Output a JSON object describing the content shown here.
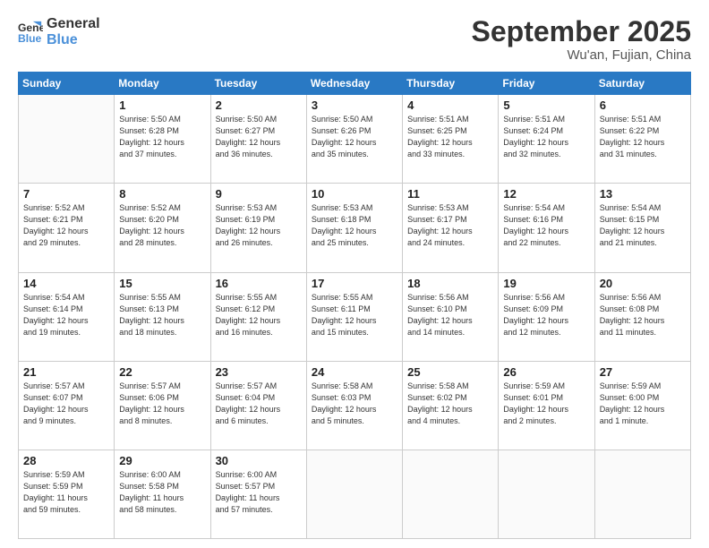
{
  "header": {
    "logo_line1": "General",
    "logo_line2": "Blue",
    "month": "September 2025",
    "location": "Wu'an, Fujian, China"
  },
  "weekdays": [
    "Sunday",
    "Monday",
    "Tuesday",
    "Wednesday",
    "Thursday",
    "Friday",
    "Saturday"
  ],
  "weeks": [
    [
      {
        "day": "",
        "info": ""
      },
      {
        "day": "1",
        "info": "Sunrise: 5:50 AM\nSunset: 6:28 PM\nDaylight: 12 hours\nand 37 minutes."
      },
      {
        "day": "2",
        "info": "Sunrise: 5:50 AM\nSunset: 6:27 PM\nDaylight: 12 hours\nand 36 minutes."
      },
      {
        "day": "3",
        "info": "Sunrise: 5:50 AM\nSunset: 6:26 PM\nDaylight: 12 hours\nand 35 minutes."
      },
      {
        "day": "4",
        "info": "Sunrise: 5:51 AM\nSunset: 6:25 PM\nDaylight: 12 hours\nand 33 minutes."
      },
      {
        "day": "5",
        "info": "Sunrise: 5:51 AM\nSunset: 6:24 PM\nDaylight: 12 hours\nand 32 minutes."
      },
      {
        "day": "6",
        "info": "Sunrise: 5:51 AM\nSunset: 6:22 PM\nDaylight: 12 hours\nand 31 minutes."
      }
    ],
    [
      {
        "day": "7",
        "info": "Sunrise: 5:52 AM\nSunset: 6:21 PM\nDaylight: 12 hours\nand 29 minutes."
      },
      {
        "day": "8",
        "info": "Sunrise: 5:52 AM\nSunset: 6:20 PM\nDaylight: 12 hours\nand 28 minutes."
      },
      {
        "day": "9",
        "info": "Sunrise: 5:53 AM\nSunset: 6:19 PM\nDaylight: 12 hours\nand 26 minutes."
      },
      {
        "day": "10",
        "info": "Sunrise: 5:53 AM\nSunset: 6:18 PM\nDaylight: 12 hours\nand 25 minutes."
      },
      {
        "day": "11",
        "info": "Sunrise: 5:53 AM\nSunset: 6:17 PM\nDaylight: 12 hours\nand 24 minutes."
      },
      {
        "day": "12",
        "info": "Sunrise: 5:54 AM\nSunset: 6:16 PM\nDaylight: 12 hours\nand 22 minutes."
      },
      {
        "day": "13",
        "info": "Sunrise: 5:54 AM\nSunset: 6:15 PM\nDaylight: 12 hours\nand 21 minutes."
      }
    ],
    [
      {
        "day": "14",
        "info": "Sunrise: 5:54 AM\nSunset: 6:14 PM\nDaylight: 12 hours\nand 19 minutes."
      },
      {
        "day": "15",
        "info": "Sunrise: 5:55 AM\nSunset: 6:13 PM\nDaylight: 12 hours\nand 18 minutes."
      },
      {
        "day": "16",
        "info": "Sunrise: 5:55 AM\nSunset: 6:12 PM\nDaylight: 12 hours\nand 16 minutes."
      },
      {
        "day": "17",
        "info": "Sunrise: 5:55 AM\nSunset: 6:11 PM\nDaylight: 12 hours\nand 15 minutes."
      },
      {
        "day": "18",
        "info": "Sunrise: 5:56 AM\nSunset: 6:10 PM\nDaylight: 12 hours\nand 14 minutes."
      },
      {
        "day": "19",
        "info": "Sunrise: 5:56 AM\nSunset: 6:09 PM\nDaylight: 12 hours\nand 12 minutes."
      },
      {
        "day": "20",
        "info": "Sunrise: 5:56 AM\nSunset: 6:08 PM\nDaylight: 12 hours\nand 11 minutes."
      }
    ],
    [
      {
        "day": "21",
        "info": "Sunrise: 5:57 AM\nSunset: 6:07 PM\nDaylight: 12 hours\nand 9 minutes."
      },
      {
        "day": "22",
        "info": "Sunrise: 5:57 AM\nSunset: 6:06 PM\nDaylight: 12 hours\nand 8 minutes."
      },
      {
        "day": "23",
        "info": "Sunrise: 5:57 AM\nSunset: 6:04 PM\nDaylight: 12 hours\nand 6 minutes."
      },
      {
        "day": "24",
        "info": "Sunrise: 5:58 AM\nSunset: 6:03 PM\nDaylight: 12 hours\nand 5 minutes."
      },
      {
        "day": "25",
        "info": "Sunrise: 5:58 AM\nSunset: 6:02 PM\nDaylight: 12 hours\nand 4 minutes."
      },
      {
        "day": "26",
        "info": "Sunrise: 5:59 AM\nSunset: 6:01 PM\nDaylight: 12 hours\nand 2 minutes."
      },
      {
        "day": "27",
        "info": "Sunrise: 5:59 AM\nSunset: 6:00 PM\nDaylight: 12 hours\nand 1 minute."
      }
    ],
    [
      {
        "day": "28",
        "info": "Sunrise: 5:59 AM\nSunset: 5:59 PM\nDaylight: 11 hours\nand 59 minutes."
      },
      {
        "day": "29",
        "info": "Sunrise: 6:00 AM\nSunset: 5:58 PM\nDaylight: 11 hours\nand 58 minutes."
      },
      {
        "day": "30",
        "info": "Sunrise: 6:00 AM\nSunset: 5:57 PM\nDaylight: 11 hours\nand 57 minutes."
      },
      {
        "day": "",
        "info": ""
      },
      {
        "day": "",
        "info": ""
      },
      {
        "day": "",
        "info": ""
      },
      {
        "day": "",
        "info": ""
      }
    ]
  ]
}
